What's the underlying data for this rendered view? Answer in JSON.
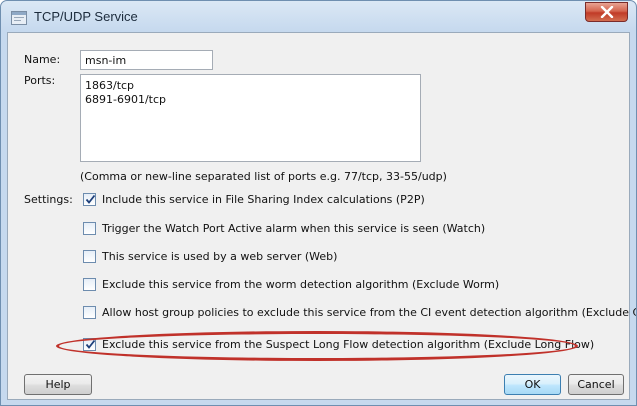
{
  "window": {
    "title": "TCP/UDP Service"
  },
  "form": {
    "name_label": "Name:",
    "name_value": "msn-im",
    "ports_label": "Ports:",
    "ports_value": "1863/tcp\n6891-6901/tcp",
    "ports_hint": "(Comma or new-line separated list of ports e.g. 77/tcp, 33-55/udp)",
    "settings_label": "Settings:"
  },
  "settings": [
    {
      "label": "Include this service in File Sharing Index calculations (P2P)",
      "checked": true
    },
    {
      "label": "Trigger the Watch Port Active alarm when this service is seen (Watch)",
      "checked": false
    },
    {
      "label": "This service is used by a web server (Web)",
      "checked": false
    },
    {
      "label": "Exclude this service from the worm detection algorithm (Exclude Worm)",
      "checked": false
    },
    {
      "label": "Allow host group policies to exclude this service from the CI event detection algorithm (Exclude CI Event)",
      "checked": false
    },
    {
      "label": "Exclude this service from the Suspect Long Flow detection algorithm (Exclude Long Flow)",
      "checked": true,
      "highlighted": true
    }
  ],
  "buttons": {
    "help": "Help",
    "ok": "OK",
    "cancel": "Cancel"
  },
  "colors": {
    "highlight": "#c0312a",
    "close_button": "#c13b27",
    "checkmark": "#1d3f7a"
  },
  "icons": {
    "title": "window-icon",
    "close": "close-icon",
    "check": "checkmark-icon"
  }
}
